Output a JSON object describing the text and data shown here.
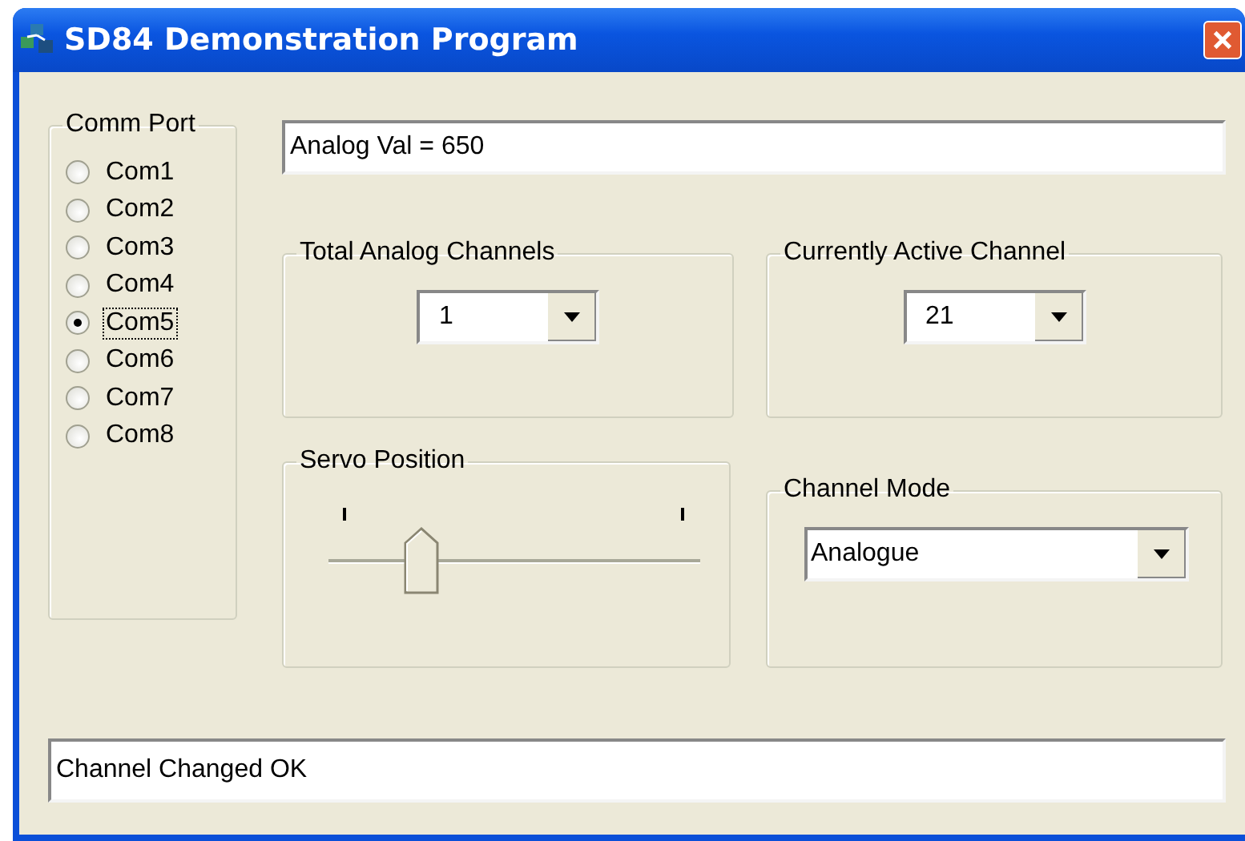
{
  "window": {
    "title": "SD84 Demonstration Program"
  },
  "comm_port": {
    "label": "Comm Port",
    "options": [
      {
        "label": "Com1",
        "selected": false
      },
      {
        "label": "Com2",
        "selected": false
      },
      {
        "label": "Com3",
        "selected": false
      },
      {
        "label": "Com4",
        "selected": false
      },
      {
        "label": "Com5",
        "selected": true
      },
      {
        "label": "Com6",
        "selected": false
      },
      {
        "label": "Com7",
        "selected": false
      },
      {
        "label": "Com8",
        "selected": false
      }
    ]
  },
  "analog_value": {
    "value": "Analog Val = 650"
  },
  "total_analog_channels": {
    "label": "Total Analog Channels",
    "value": "1"
  },
  "currently_active_channel": {
    "label": "Currently Active Channel",
    "value": "21"
  },
  "servo_position": {
    "label": "Servo Position",
    "level": 0.25
  },
  "channel_mode": {
    "label": "Channel Mode",
    "value": "Analogue"
  },
  "status": {
    "value": "Channel Changed OK"
  }
}
